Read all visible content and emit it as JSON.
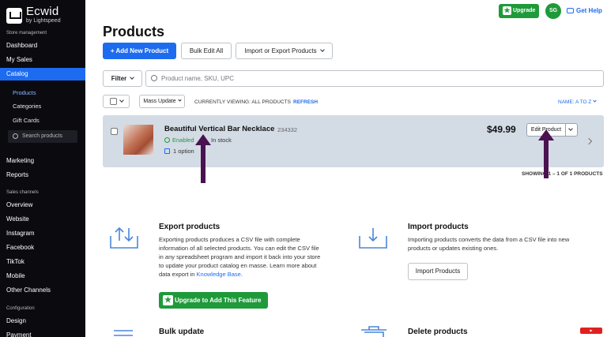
{
  "brand": {
    "name": "Ecwid",
    "sub": "by Lightspeed"
  },
  "sidebar": {
    "section_store": "Store management",
    "dashboard": "Dashboard",
    "my_sales": "My Sales",
    "catalog": "Catalog",
    "products": "Products",
    "categories": "Categories",
    "gift_cards": "Gift Cards",
    "search_placeholder": "Search products",
    "marketing": "Marketing",
    "reports": "Reports",
    "section_channels": "Sales channels",
    "overview": "Overview",
    "website": "Website",
    "instagram": "Instagram",
    "facebook": "Facebook",
    "tiktok": "TikTok",
    "mobile": "Mobile",
    "other_channels": "Other Channels",
    "section_config": "Configuration",
    "design": "Design",
    "payment": "Payment"
  },
  "topbar": {
    "upgrade": "Upgrade",
    "avatar": "SG",
    "get_help": "Get Help"
  },
  "page": {
    "title": "Products",
    "add_new": "+ Add New Product",
    "bulk_edit": "Bulk Edit All",
    "import_export": "Import or Export Products",
    "filter": "Filter",
    "search_placeholder": "Product name, SKU, UPC",
    "mass_update": "Mass Update",
    "viewing": "CURRENTLY VIEWING: ALL PRODUCTS",
    "refresh": "REFRESH",
    "sort": "NAME: A TO Z",
    "showing": "SHOWING 1 – 1 OF 1 PRODUCTS"
  },
  "product": {
    "name": "Beautiful Vertical Bar Necklace",
    "sku": "234332",
    "status": "Enabled",
    "stock": "In stock",
    "options": "1 option",
    "price": "$49.99",
    "edit": "Edit Product"
  },
  "export": {
    "title": "Export products",
    "text_1": "Exporting products produces a CSV file with complete",
    "text_2": "information of all selected products. You can edit the CSV file",
    "text_3": "in any spreadsheet program and import it back into your store",
    "text_4": "to update your product catalog en masse. Learn more about",
    "text_5_pre": "data export in ",
    "text_5_link": "Knowledge Base",
    "text_5_post": ".",
    "upgrade": "Upgrade to Add This Feature"
  },
  "import": {
    "title": "Import products",
    "text_1": "Importing products converts the data from a CSV file into new",
    "text_2": "products or updates existing ones.",
    "button": "Import Products"
  },
  "bulk": {
    "title": "Bulk update"
  },
  "delete": {
    "title": "Delete products"
  },
  "colors": {
    "accent": "#1d6cf0",
    "success": "#1f9a3a",
    "sidebar": "#0a0a0f",
    "annotation_arrow": "#4a1250"
  }
}
